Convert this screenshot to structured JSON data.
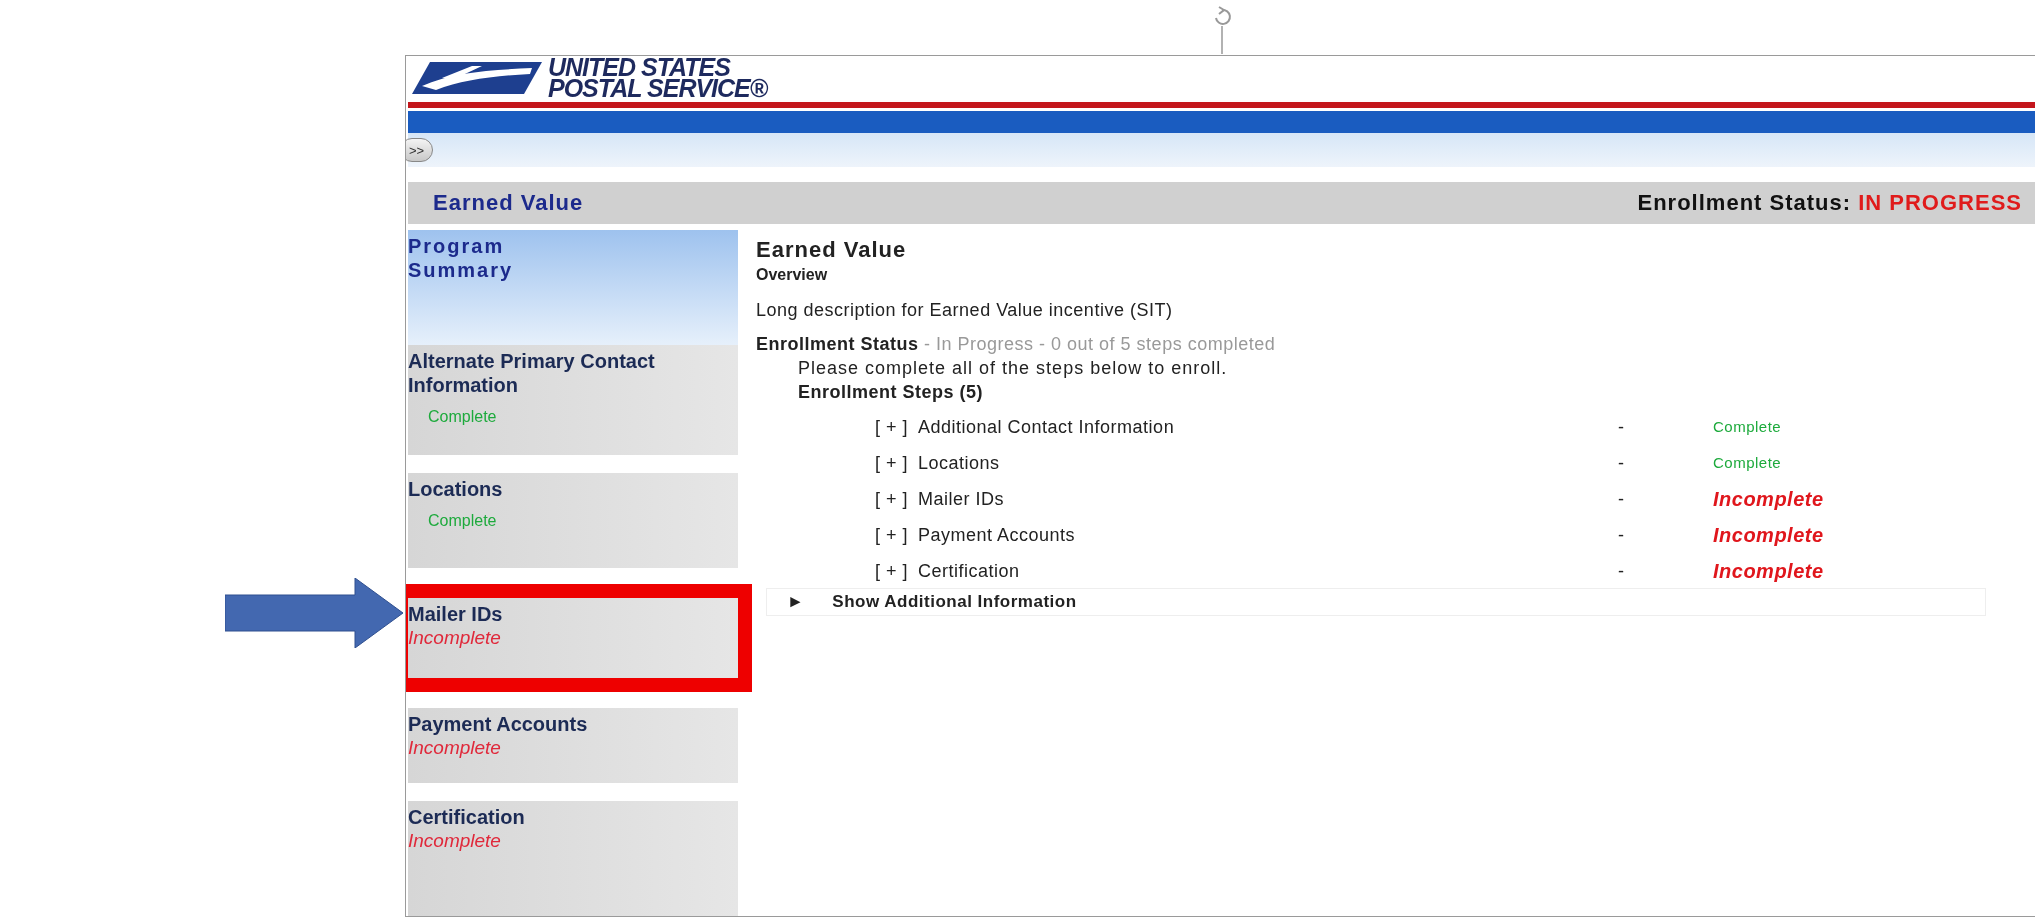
{
  "header": {
    "logo_lines": [
      "UNITED STATES",
      "POSTAL SERVICE®"
    ],
    "expand_button": ">>"
  },
  "title_bar": {
    "program": "Earned Value",
    "status_label": "Enrollment Status:",
    "status_value": "IN PROGRESS"
  },
  "sidebar": {
    "items": [
      {
        "title": "Program Summary",
        "selected": true
      },
      {
        "title": "Alternate Primary Contact Information",
        "status": "Complete",
        "complete": true,
        "selected": false
      },
      {
        "title": "Locations",
        "status": "Complete",
        "complete": true,
        "selected": false
      },
      {
        "title": "Mailer IDs",
        "status": "Incomplete",
        "complete": false,
        "selected": false,
        "highlighted": true
      },
      {
        "title": "Payment Accounts",
        "status": "Incomplete",
        "complete": false,
        "selected": false
      },
      {
        "title": "Certification",
        "status": "Incomplete",
        "complete": false,
        "selected": false
      }
    ]
  },
  "content": {
    "title": "Earned Value",
    "subtitle": "Overview",
    "description": "Long description for Earned Value incentive (SIT)",
    "enrollment_label": "Enrollment Status",
    "enrollment_detail": " - In Progress - 0 out of 5 steps completed",
    "instruction": "Please complete all of the steps below to enroll.",
    "steps_heading": "Enrollment Steps (5)",
    "steps": [
      {
        "toggle": "[ + ]",
        "name": "Additional Contact Information",
        "dash": "-",
        "status": "Complete",
        "complete": true
      },
      {
        "toggle": "[ + ]",
        "name": "Locations",
        "dash": "-",
        "status": "Complete",
        "complete": true
      },
      {
        "toggle": "[ + ]",
        "name": "Mailer IDs",
        "dash": "-",
        "status": "Incomplete",
        "complete": false
      },
      {
        "toggle": "[ + ]",
        "name": "Payment Accounts",
        "dash": "-",
        "status": "Incomplete",
        "complete": false
      },
      {
        "toggle": "[ + ]",
        "name": "Certification",
        "dash": "-",
        "status": "Incomplete",
        "complete": false
      }
    ],
    "more_toggle": "►",
    "more_label": "Show Additional Information"
  }
}
